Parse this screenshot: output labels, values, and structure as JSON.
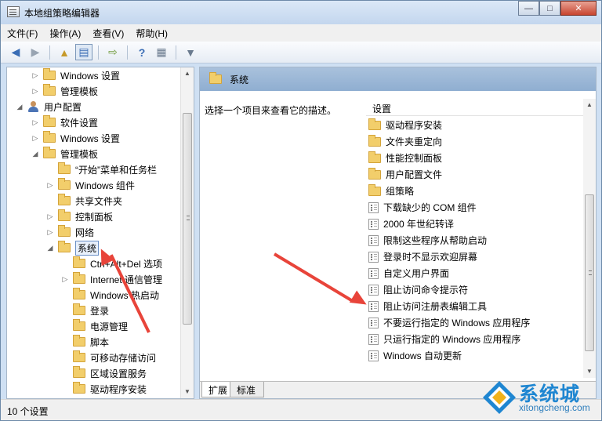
{
  "window": {
    "title": "本地组策略编辑器",
    "btn_min": "—",
    "btn_max": "□",
    "btn_close": "✕"
  },
  "menu": [
    "文件(F)",
    "操作(A)",
    "查看(V)",
    "帮助(H)"
  ],
  "toolbar": {
    "icons": [
      "back-icon",
      "forward-icon",
      "up-folder-icon",
      "show-tree-icon",
      "export-icon",
      "help-icon",
      "properties-icon",
      "filter-icon"
    ]
  },
  "tree": [
    {
      "label": "Windows 设置",
      "expander": "▷",
      "type": "folder"
    },
    {
      "label": "管理模板",
      "expander": "▷",
      "type": "folder"
    },
    {
      "label": "用户配置",
      "expander": "◢",
      "type": "user"
    },
    {
      "label": "软件设置",
      "expander": "▷",
      "type": "folder"
    },
    {
      "label": "Windows 设置",
      "expander": "▷",
      "type": "folder"
    },
    {
      "label": "管理模板",
      "expander": "◢",
      "type": "folder"
    },
    {
      "label": "“开始”菜单和任务栏",
      "expander": "",
      "type": "folder"
    },
    {
      "label": "Windows 组件",
      "expander": "▷",
      "type": "folder"
    },
    {
      "label": "共享文件夹",
      "expander": "",
      "type": "folder"
    },
    {
      "label": "控制面板",
      "expander": "▷",
      "type": "folder"
    },
    {
      "label": "网络",
      "expander": "▷",
      "type": "folder"
    },
    {
      "label": "系统",
      "expander": "◢",
      "type": "folder",
      "selected": true
    },
    {
      "label": "Ctrl+Alt+Del 选项",
      "expander": "",
      "type": "folder"
    },
    {
      "label": "Internet 通信管理",
      "expander": "▷",
      "type": "folder"
    },
    {
      "label": "Windows 热启动",
      "expander": "",
      "type": "folder"
    },
    {
      "label": "登录",
      "expander": "",
      "type": "folder"
    },
    {
      "label": "电源管理",
      "expander": "",
      "type": "folder"
    },
    {
      "label": "脚本",
      "expander": "",
      "type": "folder"
    },
    {
      "label": "可移动存储访问",
      "expander": "",
      "type": "folder"
    },
    {
      "label": "区域设置服务",
      "expander": "",
      "type": "folder"
    },
    {
      "label": "驱动程序安装",
      "expander": "",
      "type": "folder"
    }
  ],
  "right": {
    "header_title": "系统",
    "description": "选择一个项目来查看它的描述。",
    "list_header": "设置",
    "items": [
      {
        "label": "驱动程序安装",
        "type": "folder"
      },
      {
        "label": "文件夹重定向",
        "type": "folder"
      },
      {
        "label": "性能控制面板",
        "type": "folder"
      },
      {
        "label": "用户配置文件",
        "type": "folder"
      },
      {
        "label": "组策略",
        "type": "folder"
      },
      {
        "label": "下载缺少的 COM 组件",
        "type": "policy"
      },
      {
        "label": "2000 年世纪转译",
        "type": "policy"
      },
      {
        "label": "限制这些程序从帮助启动",
        "type": "policy"
      },
      {
        "label": "登录时不显示欢迎屏幕",
        "type": "policy"
      },
      {
        "label": "自定义用户界面",
        "type": "policy"
      },
      {
        "label": "阻止访问命令提示符",
        "type": "policy"
      },
      {
        "label": "阻止访问注册表编辑工具",
        "type": "policy"
      },
      {
        "label": "不要运行指定的 Windows 应用程序",
        "type": "policy"
      },
      {
        "label": "只运行指定的 Windows 应用程序",
        "type": "policy"
      },
      {
        "label": "Windows 自动更新",
        "type": "policy"
      }
    ],
    "tabs": [
      "扩展",
      "标准"
    ]
  },
  "status": "10 个设置",
  "colors": {
    "annotation_arrow": "#e8443a",
    "logo_blue": "#1f86d1"
  },
  "watermark": {
    "text": "系统城",
    "url": "xitongcheng.com"
  }
}
